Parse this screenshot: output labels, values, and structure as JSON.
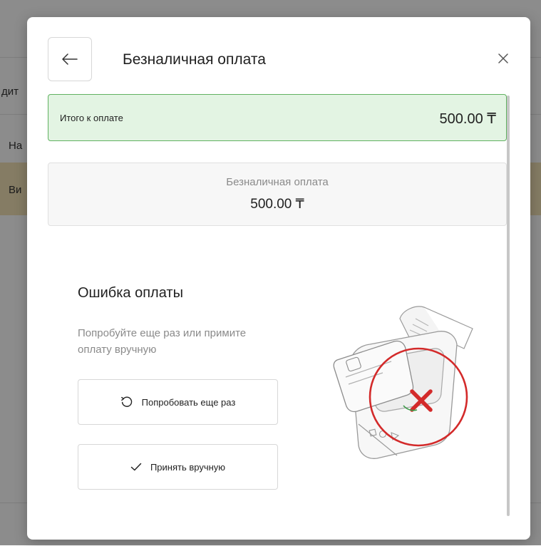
{
  "background": {
    "col_partial_1": "дит",
    "row_header_partial": "На",
    "row_highlight_partial": "Ви"
  },
  "modal": {
    "title": "Безналичная оплата",
    "back_icon": "arrow-left-icon",
    "close_icon": "close-icon",
    "total": {
      "label": "Итого к оплате",
      "value": "500.00 ₸"
    },
    "payment_method": {
      "label": "Безналичная оплата",
      "amount": "500.00 ₸"
    },
    "error": {
      "title": "Ошибка оплаты",
      "description": "Попробуйте еще раз или примите оплату вручную"
    },
    "buttons": {
      "retry_label": "Попробовать еще раз",
      "retry_icon": "retry-icon",
      "accept_label": "Принять вручную",
      "accept_icon": "check-icon"
    },
    "illustration": "payment-terminal-error-illustration"
  },
  "colors": {
    "total_bg": "#e3f4e3",
    "total_border": "#61b261",
    "error_red": "#d32a2a",
    "highlight_row": "#f3e2b7"
  }
}
